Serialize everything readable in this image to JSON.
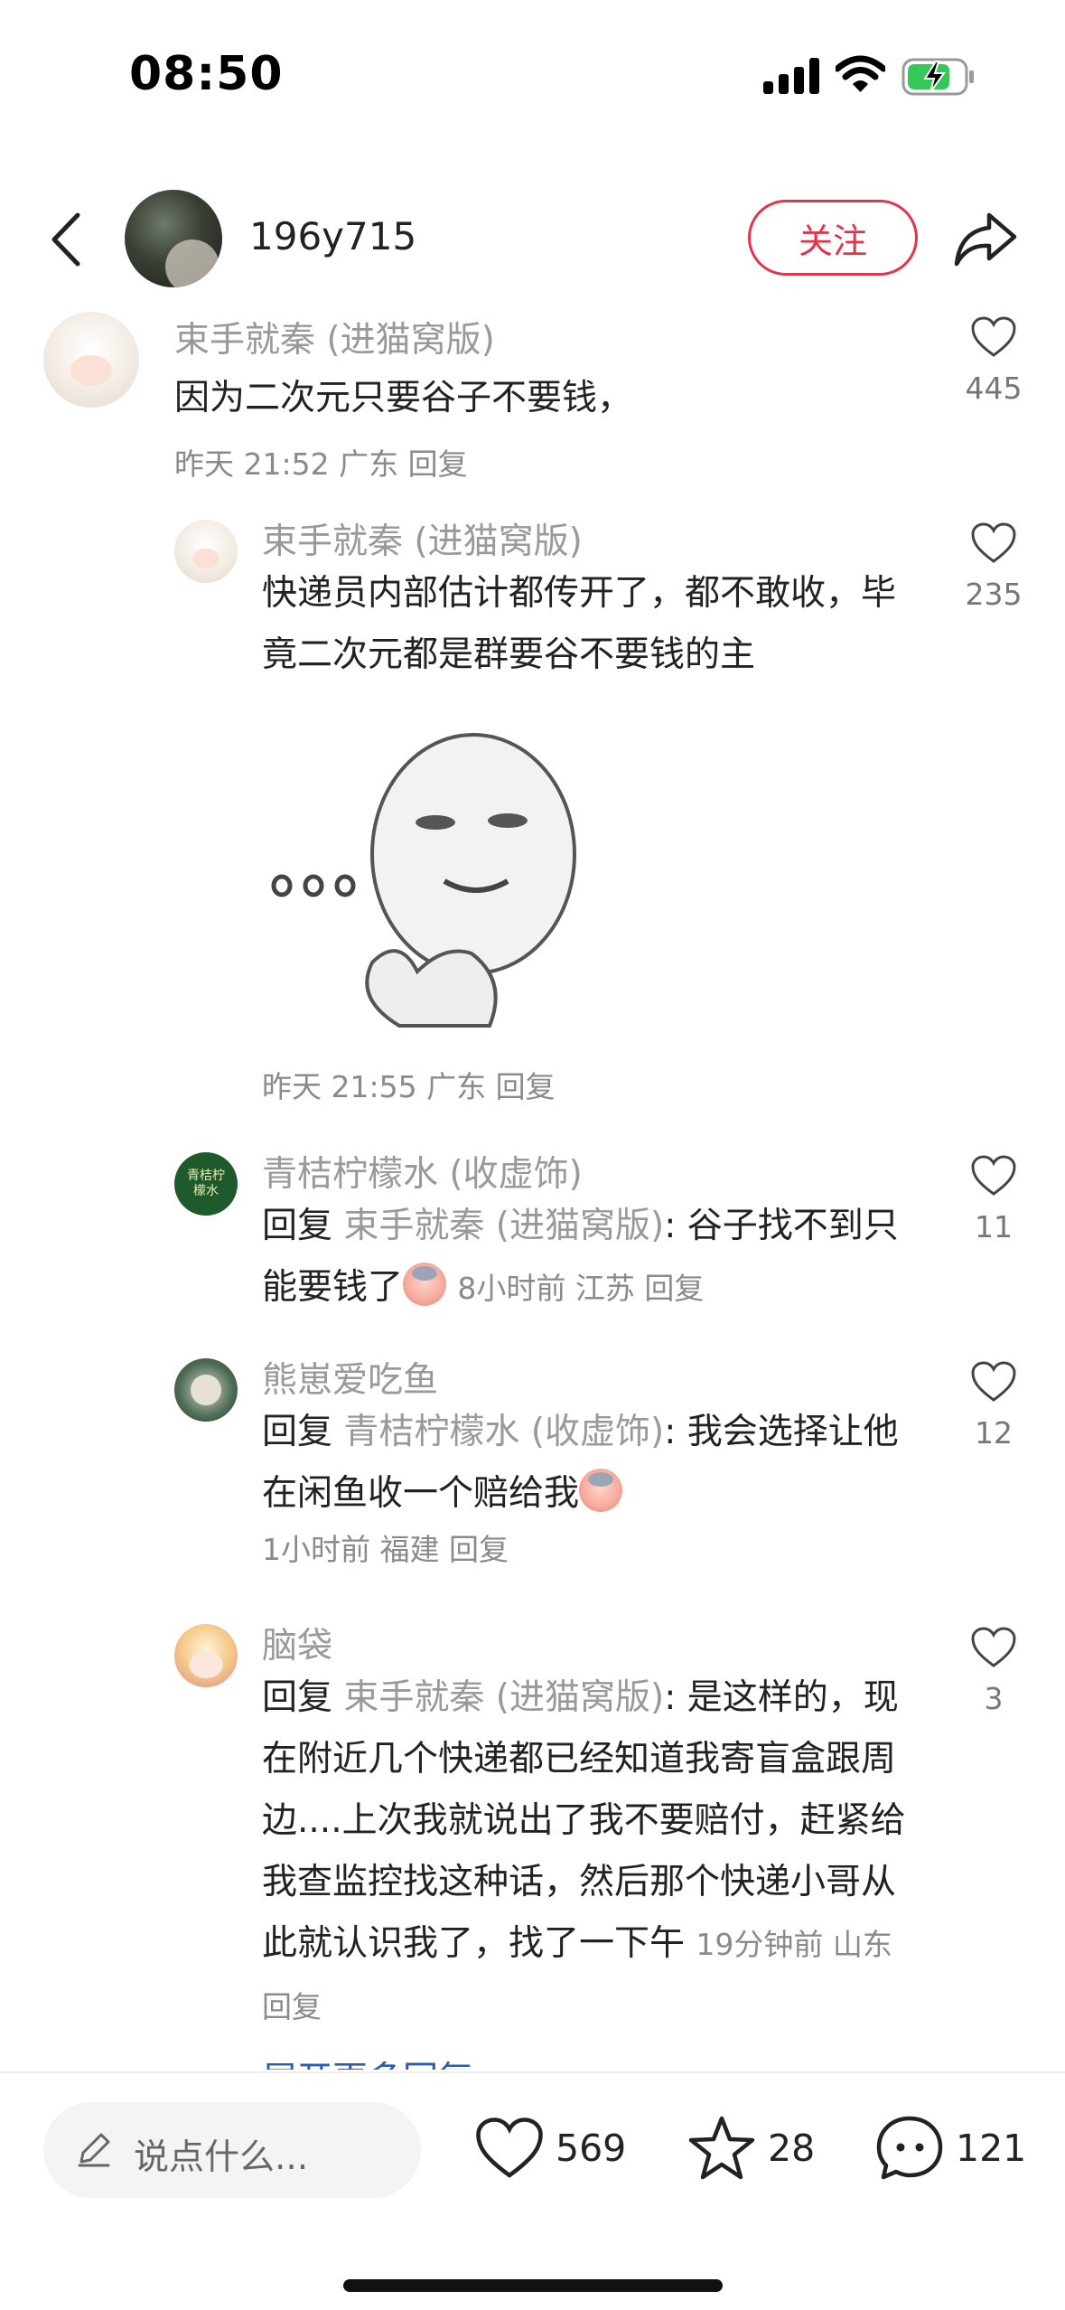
{
  "status_bar": {
    "time": "08:50"
  },
  "header": {
    "author_name": "196y715",
    "follow_label": "关注"
  },
  "comments": [
    {
      "nickname": "束手就秦 (进猫窝版)",
      "text": "因为二次元只要谷子不要钱，",
      "meta": "昨天 21:52 广东 回复",
      "likes": "445"
    },
    {
      "nickname": "束手就秦 (进猫窝版)",
      "text": "快递员内部估计都传开了，都不敢收，毕竟二次元都是群要谷不要钱的主",
      "meta": "昨天 21:55 广东 回复",
      "likes": "235"
    },
    {
      "nickname": "青桔柠檬水 (收虚饰)",
      "avatar_text": "青桔柠檬水",
      "reply_prefix": "回复 ",
      "reply_to": "束手就秦 (进猫窝版)",
      "text": ": 谷子找不到只能要钱了",
      "meta": "8小时前 江苏 回复",
      "likes": "11"
    },
    {
      "nickname": "熊崽爱吃鱼",
      "reply_prefix": "回复 ",
      "reply_to": "青桔柠檬水 (收虚饰)",
      "text": ": 我会选择让他在闲鱼收一个赔给我",
      "meta": "1小时前 福建 回复",
      "likes": "12"
    },
    {
      "nickname": "脑袋",
      "reply_prefix": "回复 ",
      "reply_to": "束手就秦 (进猫窝版)",
      "text": ": 是这样的，现在附近几个快递都已经知道我寄盲盒跟周边....上次我就说出了我不要赔付，赶紧给我查监控找这种话，然后那个快递小哥从此就认识我了，找了一下午",
      "meta": "19分钟前 山东 回复",
      "likes": "3"
    }
  ],
  "expand_more": "展开更多回复",
  "bottom_bar": {
    "input_placeholder": "说点什么...",
    "likes": "569",
    "stars": "28",
    "comments": "121"
  },
  "icons": {
    "back": "chevron-left-icon",
    "share": "share-arrow-icon",
    "like": "heart-outline-icon",
    "star": "star-outline-icon",
    "comment": "chat-bubble-icon",
    "pencil": "pencil-icon"
  },
  "colors": {
    "accent": "#e5334b",
    "link": "#2a5db0",
    "muted": "#999999"
  }
}
